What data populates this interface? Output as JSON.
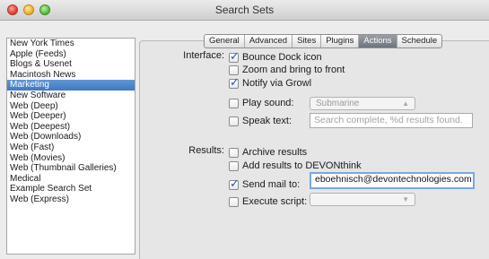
{
  "window": {
    "title": "Search Sets"
  },
  "sidebar": {
    "items": [
      {
        "label": "New York Times"
      },
      {
        "label": "Apple (Feeds)"
      },
      {
        "label": "Blogs & Usenet"
      },
      {
        "label": "Macintosh News"
      },
      {
        "label": "Marketing",
        "selected": true
      },
      {
        "label": "New Software"
      },
      {
        "label": "Web (Deep)"
      },
      {
        "label": "Web (Deeper)"
      },
      {
        "label": "Web (Deepest)"
      },
      {
        "label": "Web (Downloads)"
      },
      {
        "label": "Web (Fast)"
      },
      {
        "label": "Web (Movies)"
      },
      {
        "label": "Web (Thumbnail Galleries)"
      },
      {
        "label": "Medical"
      },
      {
        "label": "Example Search Set"
      },
      {
        "label": "Web (Express)"
      }
    ]
  },
  "tabs": [
    {
      "label": "General"
    },
    {
      "label": "Advanced"
    },
    {
      "label": "Sites"
    },
    {
      "label": "Plugins"
    },
    {
      "label": "Actions",
      "active": true
    },
    {
      "label": "Schedule"
    }
  ],
  "interface": {
    "label": "Interface:",
    "bounce_dock": {
      "label": "Bounce Dock icon",
      "checked": true
    },
    "zoom_front": {
      "label": "Zoom and bring to front",
      "checked": false
    },
    "notify_growl": {
      "label": "Notify via Growl",
      "checked": true
    },
    "play_sound": {
      "label": "Play sound:",
      "checked": false,
      "sound_value": "Submarine"
    },
    "speak_text": {
      "label": "Speak text:",
      "checked": false,
      "placeholder": "Search complete, %d results found."
    }
  },
  "results": {
    "label": "Results:",
    "archive": {
      "label": "Archive results",
      "checked": false
    },
    "add_devonthink": {
      "label": "Add results to DEVONthink",
      "checked": false
    },
    "send_mail": {
      "label": "Send mail to:",
      "checked": true,
      "value": "eboehnisch@devontechnologies.com"
    },
    "execute_script": {
      "label": "Execute script:",
      "checked": false,
      "value": ""
    }
  }
}
